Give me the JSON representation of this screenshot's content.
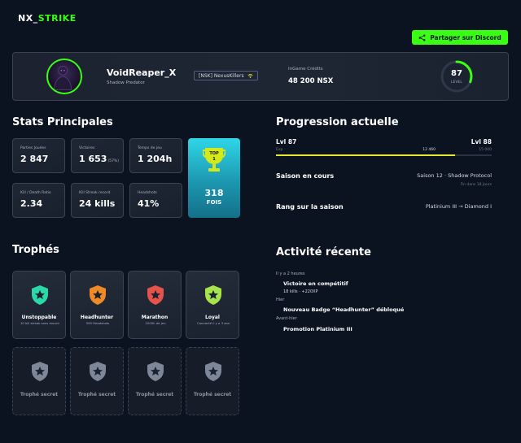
{
  "header": {
    "logo_part1": "NX_",
    "logo_part2": "STRIKE",
    "share_label": "Partager sur Discord"
  },
  "profile": {
    "username": "VoidReaper_X",
    "title": "Shadow Predator",
    "clan": "[NSK] NexusKillers",
    "credits_label": "InGame Crédits",
    "credits_value": "48 200 NSX",
    "level": "87",
    "level_label": "LEVEL",
    "level_progress": 0.31
  },
  "stats": {
    "title": "Stats Principales",
    "cards": [
      {
        "label": "Parties Jouées",
        "value": "2 847",
        "unit": ""
      },
      {
        "label": "Victoires",
        "value": "1 653",
        "unit": "(57%)"
      },
      {
        "label": "Temps de jeu",
        "value": "1 204h",
        "unit": ""
      },
      {
        "label": "Kill / Death Ratio",
        "value": "2.34",
        "unit": ""
      },
      {
        "label": "Kill Streak record",
        "value": "24 kills",
        "unit": ""
      },
      {
        "label": "Headshots",
        "value": "41%",
        "unit": ""
      }
    ],
    "top": {
      "badge": "TOP",
      "rank": "1",
      "value": "318",
      "unit": "FOIS"
    }
  },
  "progression": {
    "title": "Progression actuelle",
    "current_level": "Lvl 87",
    "next_level": "Lvl 88",
    "xp_label": "Exp",
    "xp_current": "12 460",
    "xp_target": "15 000",
    "xp_fraction": 0.83,
    "season_label": "Saison en cours",
    "season_value": "Saison 12 · Shadow Protocol",
    "season_end": "Fin dans 18 Jours",
    "rank_label": "Rang sur la saison",
    "rank_value": "Platinium III  →  Diamond I"
  },
  "trophies": {
    "title": "Trophés",
    "items": [
      {
        "name": "Unstoppable",
        "desc": "10 kill streak sans mourir",
        "color": "#2bd9a8"
      },
      {
        "name": "Headhunter",
        "desc": "500 Headshots",
        "color": "#f08a24"
      },
      {
        "name": "Marathon",
        "desc": "1000h de jeu",
        "color": "#e5534b"
      },
      {
        "name": "Loyal",
        "desc": "Connecté il y a 3 ans",
        "color": "#a7e34a"
      }
    ],
    "locked_label": "Trophé secret"
  },
  "activity": {
    "title": "Activité récente",
    "items": [
      {
        "time": "Il y a 2 heures",
        "title": "Victoire en compétitif",
        "sub": "18 kills · +220XP"
      },
      {
        "time": "Hier",
        "title": "Nouveau Badge “Headhunter” débloqué",
        "sub": ""
      },
      {
        "time": "Avant-hier",
        "title": "Promotion Platinium III",
        "sub": ""
      }
    ]
  }
}
